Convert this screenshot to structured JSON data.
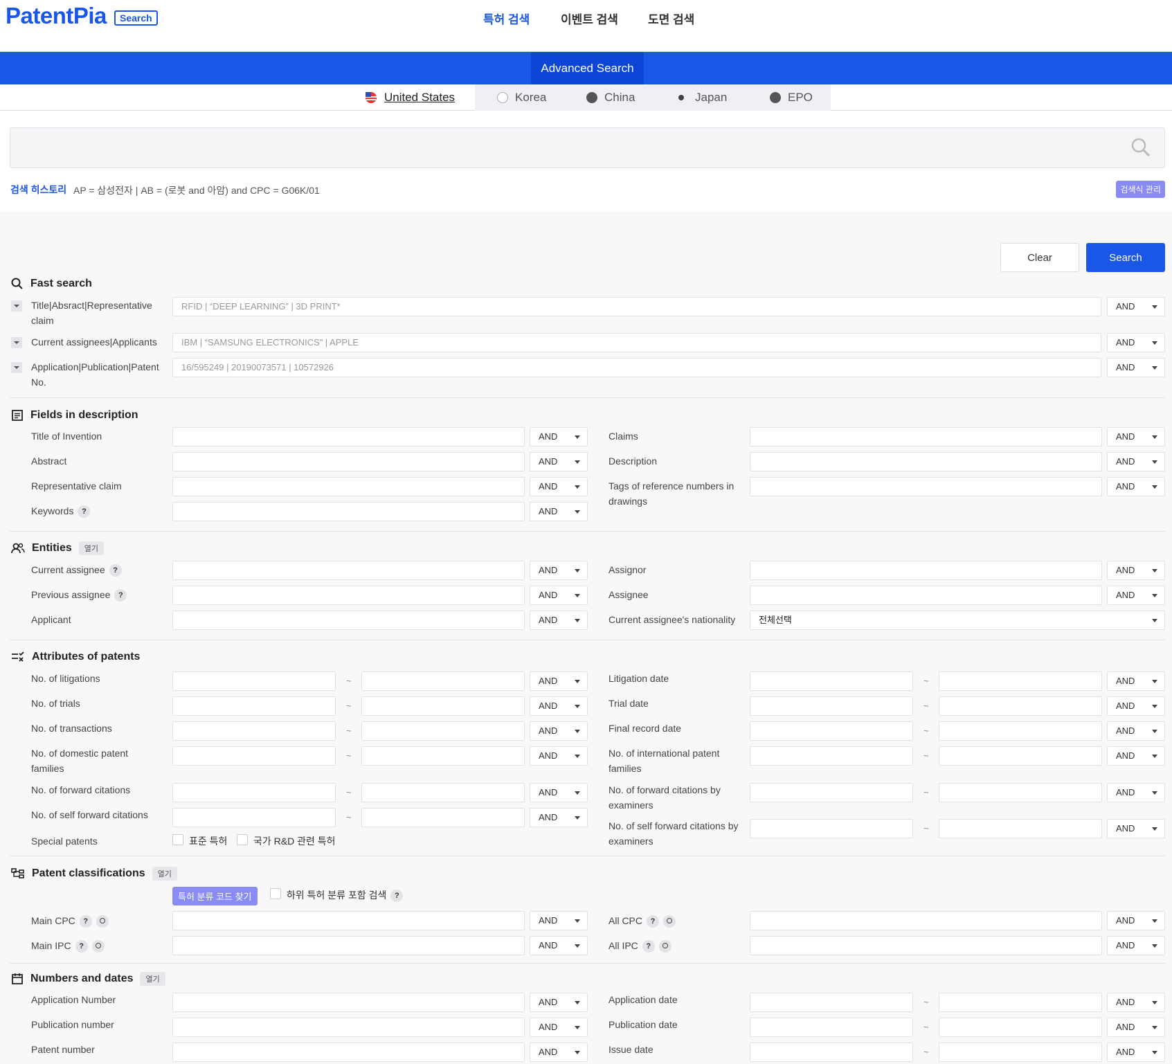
{
  "header": {
    "logo": "PatentPia",
    "logo_badge": "Search",
    "nav": [
      "특허 검색",
      "이벤트 검색",
      "도면 검색"
    ]
  },
  "adv_tab": "Advanced Search",
  "countries": [
    "United States",
    "Korea",
    "China",
    "Japan",
    "EPO"
  ],
  "history": {
    "label": "검색 히스토리",
    "text": "AP = 삼성전자 | AB = (로봇 and 아암) and CPC = G06K/01",
    "manage": "검색식 관리"
  },
  "buttons": {
    "clear": "Clear",
    "search": "Search"
  },
  "op": "AND",
  "fast": {
    "title": "Fast search",
    "rows": [
      {
        "label": "Title|Absract|Representative claim",
        "ph": "RFID | “DEEP LEARNING” | 3D PRINT*"
      },
      {
        "label": "Current assignees|Applicants",
        "ph": "IBM | “SAMSUNG ELECTRONICS” | APPLE"
      },
      {
        "label": "Application|Publication|Patent No.",
        "ph": "16/595249 | 20190073571 | 10572926"
      }
    ]
  },
  "desc": {
    "title": "Fields in description",
    "left": [
      "Title of Invention",
      "Abstract",
      "Representative claim",
      "Keywords"
    ],
    "right": [
      "Claims",
      "Description",
      "Tags of reference numbers in drawings"
    ]
  },
  "entities": {
    "title": "Entities",
    "badge": "열기",
    "left": [
      "Current assignee",
      "Previous assignee",
      "Applicant"
    ],
    "right": [
      "Assignor",
      "Assignee",
      "Current assignee's nationality"
    ],
    "nationality": "전체선택"
  },
  "attr": {
    "title": "Attributes of patents",
    "left": [
      "No. of litigations",
      "No. of trials",
      "No. of transactions",
      "No. of domestic patent families",
      "No. of forward citations",
      "No. of self forward citations"
    ],
    "right": [
      "Litigation date",
      "Trial date",
      "Final record date",
      "No. of international patent families",
      "No. of forward citations by examiners",
      "No. of self forward citations by examiners"
    ],
    "special": "Special patents",
    "chk1": "표준 특허",
    "chk2": "국가 R&D 관련 특허",
    "tilde": "~"
  },
  "cls": {
    "title": "Patent classifications",
    "badge": "열기",
    "find": "특허 분류 코드 찾기",
    "sub": "하위 특허 분류 포함 검색",
    "left": [
      "Main CPC",
      "Main IPC"
    ],
    "right": [
      "All CPC",
      "All IPC"
    ]
  },
  "nums": {
    "title": "Numbers and dates",
    "badge": "열기",
    "left": [
      "Application Number",
      "Publication number",
      "Patent number"
    ],
    "right": [
      "Application date",
      "Publication date",
      "Issue date"
    ]
  }
}
